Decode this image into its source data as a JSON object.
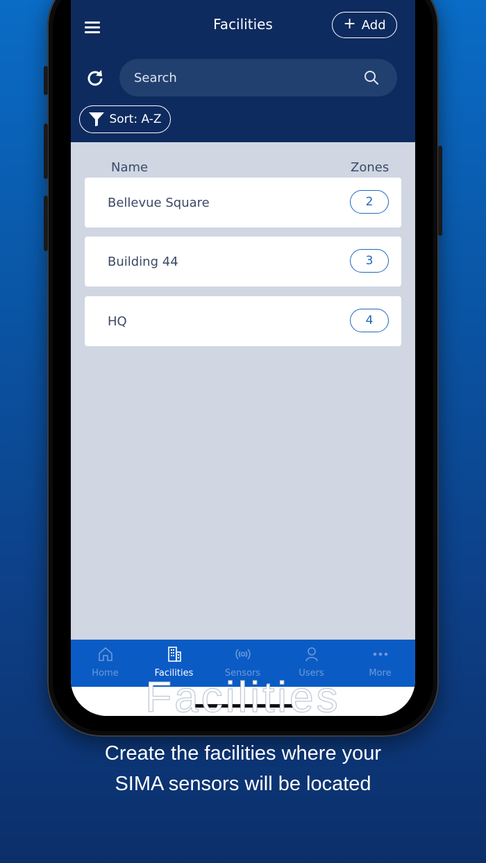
{
  "header": {
    "title": "Facilities",
    "add_label": "Add",
    "search_placeholder": "Search",
    "sort_label": "Sort: A-Z"
  },
  "list": {
    "col_name": "Name",
    "col_zones": "Zones",
    "rows": [
      {
        "name": "Bellevue Square",
        "zones": "2"
      },
      {
        "name": "Building 44",
        "zones": "3"
      },
      {
        "name": "HQ",
        "zones": "4"
      }
    ]
  },
  "tabs": [
    {
      "label": "Home",
      "icon": "home-icon"
    },
    {
      "label": "Facilities",
      "icon": "building-icon",
      "active": true
    },
    {
      "label": "Sensors",
      "icon": "sensor-icon"
    },
    {
      "label": "Users",
      "icon": "user-icon"
    },
    {
      "label": "More",
      "icon": "more-icon"
    }
  ],
  "promo": {
    "title": "Facilities",
    "caption_line1": "Create the facilities where your",
    "caption_line2": "SIMA sensors will be located"
  },
  "colors": {
    "header_bg": "#0e2b5f",
    "content_bg": "#d0d6e2",
    "tabbar_bg": "#0b5bc5",
    "accent": "#1f66c2"
  }
}
